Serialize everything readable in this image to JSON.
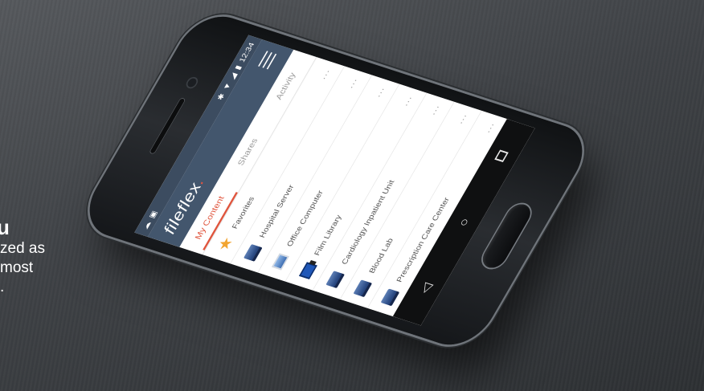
{
  "caption": {
    "heading": "u",
    "lines": [
      "zed as",
      "most",
      "."
    ]
  },
  "status_bar": {
    "left_icons": [
      "cloud-icon",
      "card-icon"
    ],
    "right_icons": [
      "bluetooth-icon",
      "wifi-icon",
      "signal-icon",
      "battery-icon"
    ],
    "time": "12:34"
  },
  "app": {
    "logo_text": "fileflex",
    "logo_dot": "."
  },
  "tabs": [
    {
      "label": "My Content",
      "active": true
    },
    {
      "label": "Shares",
      "active": false
    },
    {
      "label": "Activity",
      "active": false
    }
  ],
  "list": [
    {
      "icon": "star-icon",
      "label": "Favorites"
    },
    {
      "icon": "server-icon",
      "label": "Hospital Server"
    },
    {
      "icon": "computer-icon",
      "label": "Office Computer"
    },
    {
      "icon": "film-library-icon",
      "label": "Film Library"
    },
    {
      "icon": "server-icon",
      "label": "Cardiology Inpatient Unit"
    },
    {
      "icon": "server-icon",
      "label": "Blood Lab"
    },
    {
      "icon": "server-icon",
      "label": "Prescription Care Center"
    }
  ],
  "more_label": "...",
  "nav": {
    "back": "◁",
    "home": "○",
    "recents": "□"
  },
  "colors": {
    "accent": "#e0543c",
    "app_bar": "#43566d",
    "status_bar": "#3c4c60"
  }
}
